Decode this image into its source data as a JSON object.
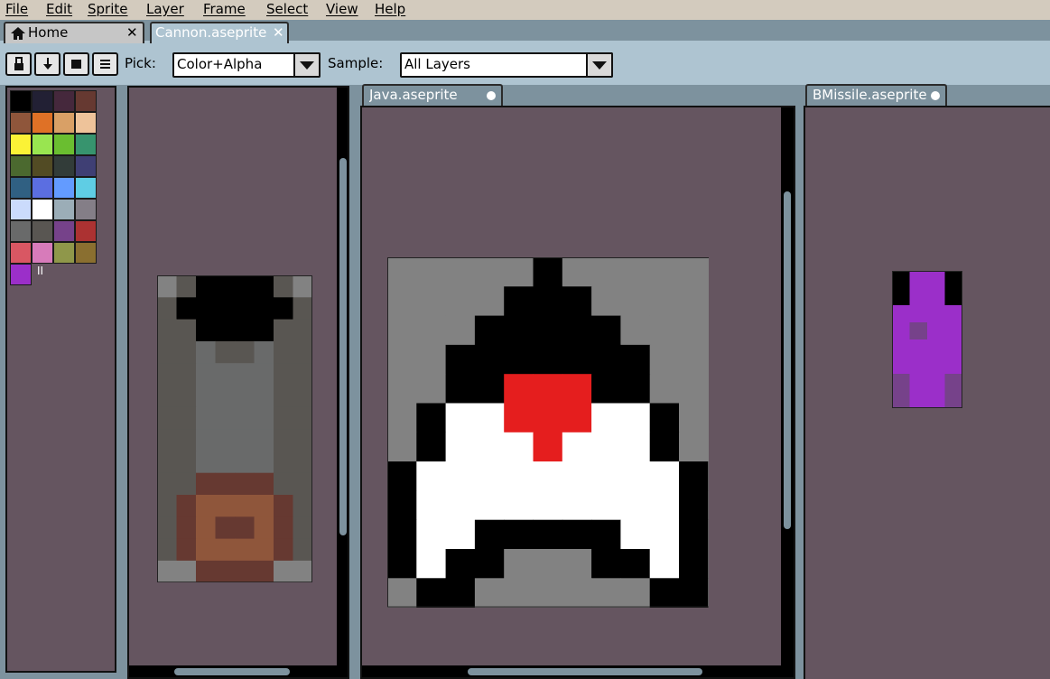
{
  "menu": [
    "File",
    "Edit",
    "Sprite",
    "Layer",
    "Frame",
    "Select",
    "View",
    "Help"
  ],
  "tabs": {
    "home": {
      "label": "Home",
      "icon": "home-icon",
      "close": "✕"
    },
    "cannon": {
      "label": "Cannon.aseprite",
      "close": "✕"
    }
  },
  "toolbar": {
    "buttons": [
      "lock-icon",
      "arrow-down-icon",
      "square-icon",
      "menu-icon"
    ],
    "pick_label": "Pick:",
    "pick_value": "Color+Alpha",
    "sample_label": "Sample:",
    "sample_value": "All Layers"
  },
  "palette": {
    "colors": [
      "#000000",
      "#222034",
      "#45283c",
      "#663931",
      "#8f563b",
      "#df7126",
      "#d9a066",
      "#eec39a",
      "#fbf236",
      "#99e550",
      "#6abe30",
      "#37946e",
      "#4b692f",
      "#524b24",
      "#323c39",
      "#3f3f74",
      "#306082",
      "#5b6ee1",
      "#639bff",
      "#5fcde4",
      "#cbdbfc",
      "#ffffff",
      "#9badb7",
      "#847e87",
      "#696a6a",
      "#595652",
      "#76428a",
      "#ac3232",
      "#d95763",
      "#d77bba",
      "#8f974a",
      "#8a6f30",
      "#9b2fc9"
    ],
    "extra_mark": "II"
  },
  "documents": {
    "java": {
      "tab_label": "Java.aseprite"
    },
    "bmissile": {
      "tab_label": "BMissile.aseprite"
    }
  },
  "colors": {
    "menubar": "#d3cbbe",
    "workspace": "#7d929e",
    "canvas_bg": "#655560",
    "accent": "#aec4d1"
  }
}
